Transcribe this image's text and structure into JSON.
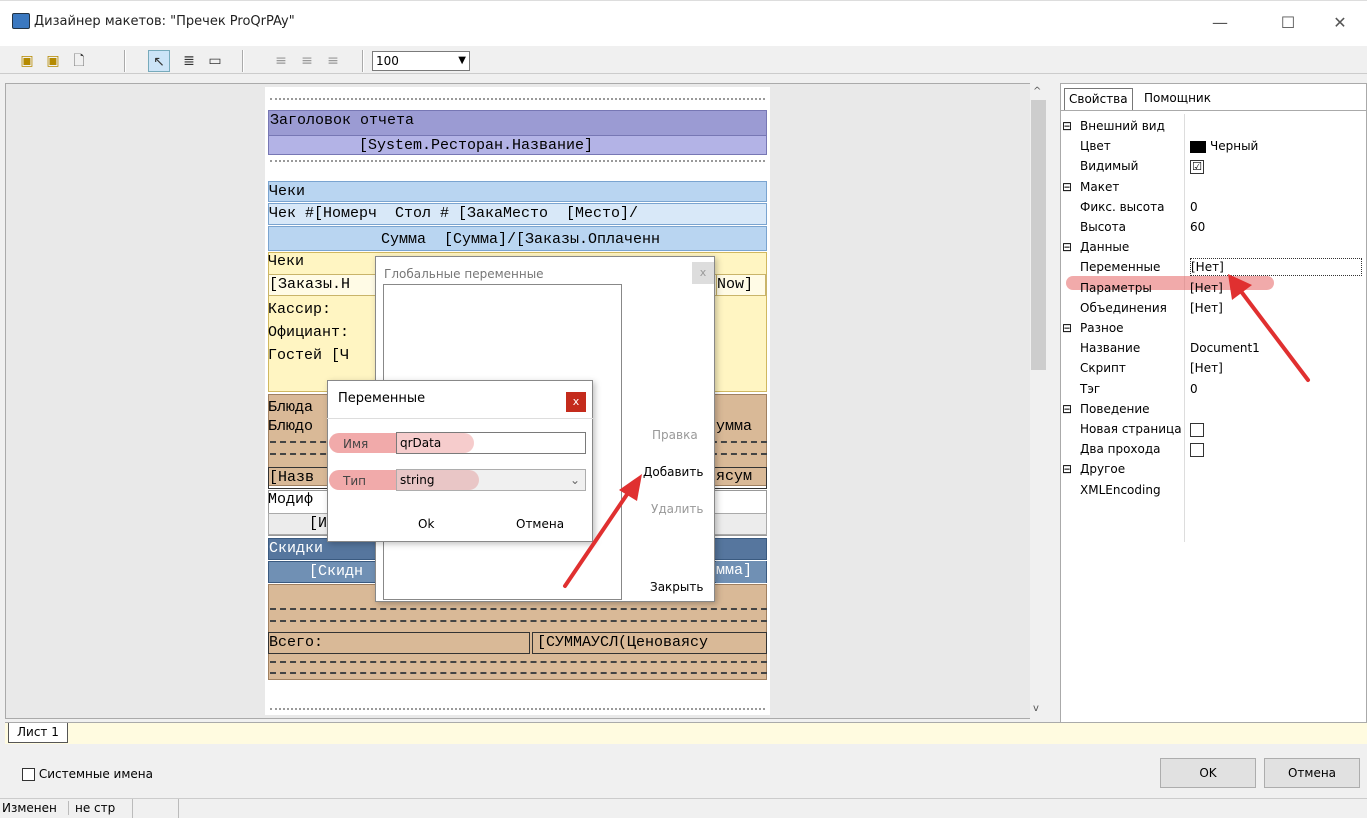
{
  "window": {
    "title": "Дизайнер макетов: \"Пречек ProQrPAy\"",
    "min": "—",
    "max": "☐",
    "close": "✕"
  },
  "toolbar": {
    "zoom": "100"
  },
  "report": {
    "header_title": "Заголовок отчета",
    "header_field": "[System.Ресторан.Название]",
    "checks1": "Чеки",
    "check_line": "Чек #[Номерч  Стол # [ЗакаМесто  [Место]/",
    "sum_line": "Сумма  [Сумма]/[Заказы.Оплаченн",
    "checks2": "Чеки",
    "orders_line": "[Заказы.Н",
    "now_tail": "Now]",
    "cashier": "Кассир:",
    "waiter": "Официант:",
    "guests": "Гостей [Ч",
    "dish1": "Блюда",
    "dish2": "Блюдо",
    "summa_tail": "умма",
    "name_line": "[Назв",
    "yasum_tail": "ясум",
    "modif": "Модиф",
    "modif_field": "[И",
    "discounts": "Скидки",
    "discount_field": "[Скидн",
    "mma_tail": "мма]",
    "total_label": "Всего:",
    "total_field": "[СУММАУСЛ(Ценоваясу"
  },
  "global_vars": {
    "title": "Глобальные переменные",
    "edit": "Правка",
    "add": "Добавить",
    "delete": "Удалить",
    "close": "Закрыть"
  },
  "var_dialog": {
    "title": "Переменные",
    "name_label": "Имя",
    "name_value": "qrData",
    "type_label": "Тип",
    "type_value": "string",
    "ok": "Ok",
    "cancel": "Отмена"
  },
  "sheet_tab": "Лист 1",
  "props": {
    "tabs": [
      "Свойства",
      "Помощник"
    ],
    "rows": [
      {
        "kind": "cat",
        "label": "Внешний вид"
      },
      {
        "kind": "prop",
        "name": "Цвет",
        "value": "Черный",
        "swatch": "#000000"
      },
      {
        "kind": "prop",
        "name": "Видимый",
        "value": "",
        "check": "☑"
      },
      {
        "kind": "cat",
        "label": "Макет"
      },
      {
        "kind": "prop",
        "name": "Фикс. высота",
        "value": "0"
      },
      {
        "kind": "prop",
        "name": "Высота",
        "value": "60"
      },
      {
        "kind": "cat",
        "label": "Данные"
      },
      {
        "kind": "prop",
        "name": "Переменные",
        "value": "[Нет]",
        "highlight": true
      },
      {
        "kind": "prop",
        "name": "Параметры",
        "value": "[Нет]"
      },
      {
        "kind": "prop",
        "name": "Объединения",
        "value": "[Нет]"
      },
      {
        "kind": "cat",
        "label": "Разное"
      },
      {
        "kind": "prop",
        "name": "Название",
        "value": "Document1"
      },
      {
        "kind": "prop",
        "name": "Скрипт",
        "value": "[Нет]"
      },
      {
        "kind": "prop",
        "name": "Тэг",
        "value": "0"
      },
      {
        "kind": "cat",
        "label": "Поведение"
      },
      {
        "kind": "prop",
        "name": "Новая страница",
        "value": "",
        "check": ""
      },
      {
        "kind": "prop",
        "name": "Два прохода",
        "value": "",
        "check": ""
      },
      {
        "kind": "cat",
        "label": "Другое"
      },
      {
        "kind": "prop",
        "name": "XMLEncoding",
        "value": ""
      }
    ]
  },
  "footer": {
    "system_names": "Системные имена",
    "ok": "OK",
    "cancel": "Отмена"
  },
  "status": {
    "changed": "Изменен",
    "page": "не стр"
  },
  "colors": {
    "header_band": "#9d9dd6",
    "checks_band": "#b8d4f0",
    "yellow_band": "#fff5c4",
    "tan_band": "#dcbc9a",
    "blue_band": "#5a7aa6",
    "arrow": "#e03030"
  }
}
